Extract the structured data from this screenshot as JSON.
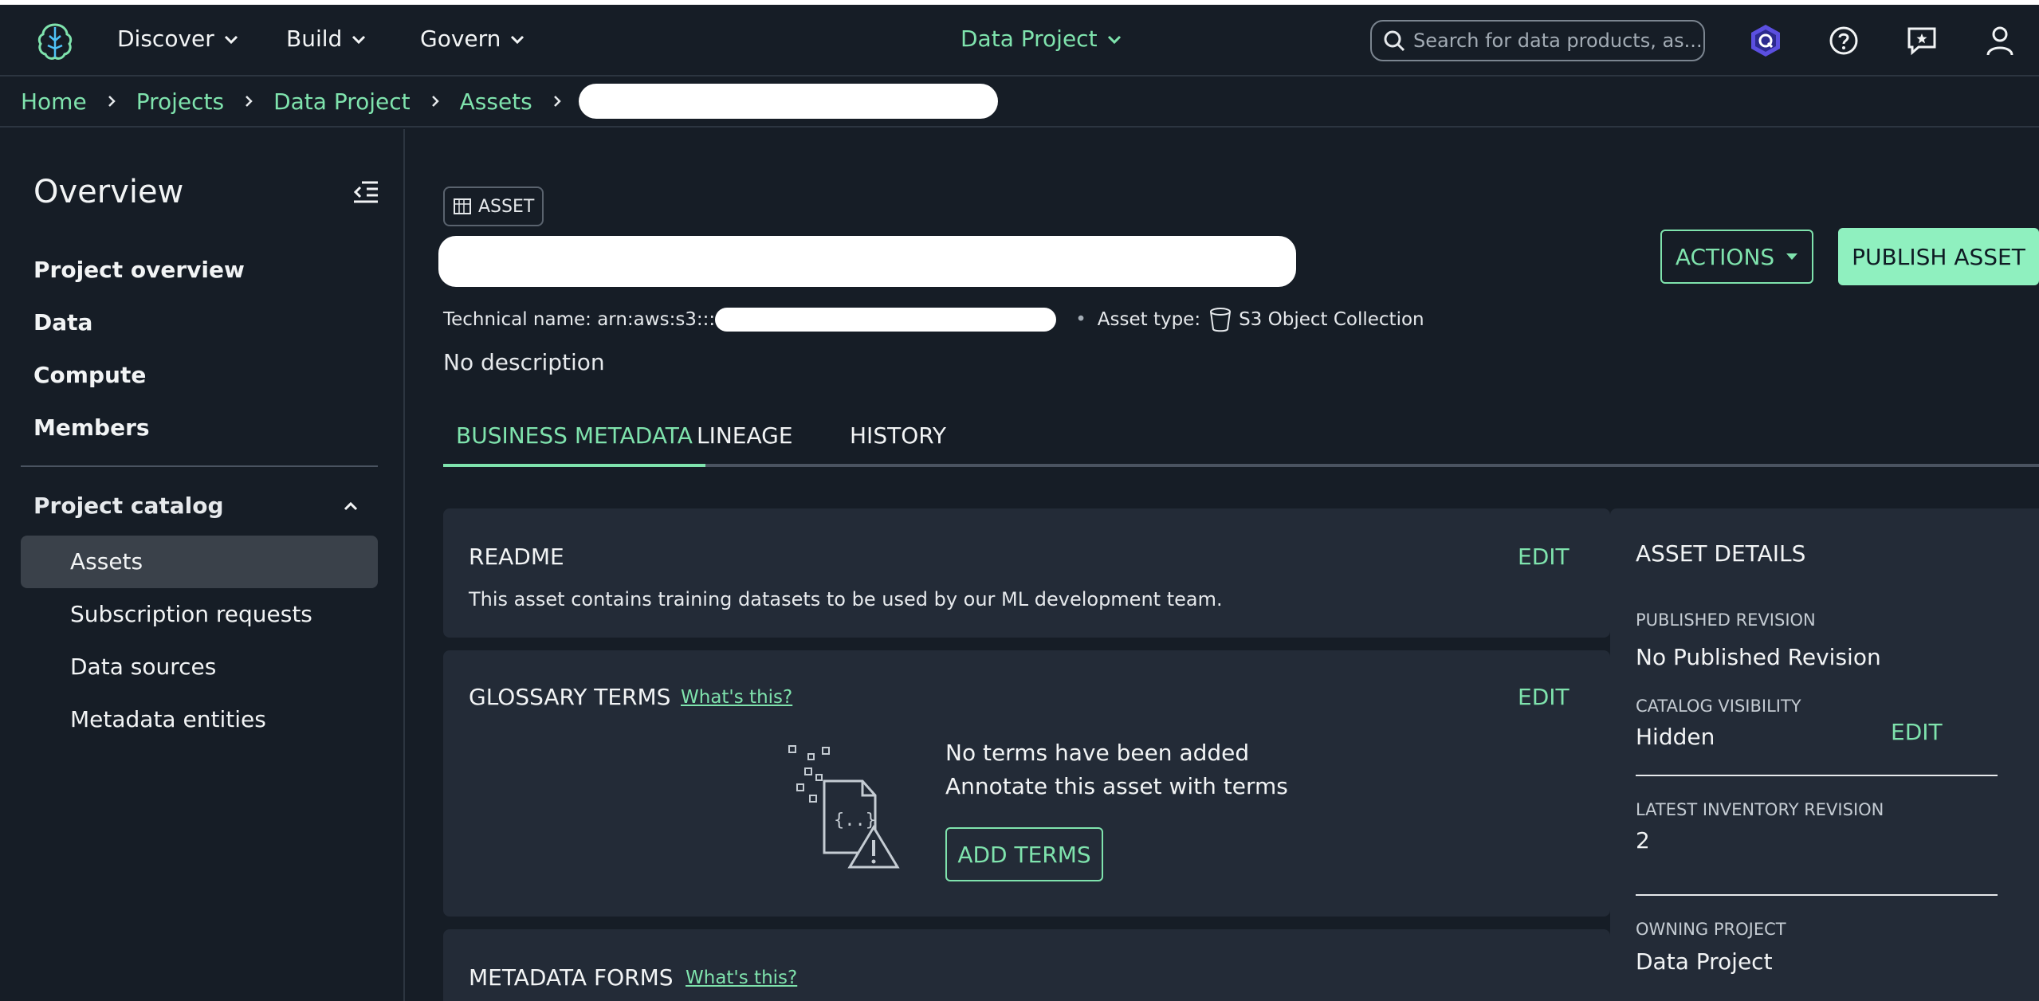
{
  "header": {
    "nav": [
      {
        "label": "Discover"
      },
      {
        "label": "Build"
      },
      {
        "label": "Govern"
      }
    ],
    "project_switcher": "Data Project",
    "search": {
      "placeholder": "Search for data products, as...",
      "value": ""
    },
    "icons": [
      "amazon-q-icon",
      "help-icon",
      "feedback-icon",
      "user-icon"
    ]
  },
  "breadcrumb": {
    "items": [
      "Home",
      "Projects",
      "Data Project",
      "Assets"
    ]
  },
  "sidebar": {
    "title": "Overview",
    "links": [
      "Project overview",
      "Data",
      "Compute",
      "Members"
    ],
    "catalog": {
      "label": "Project catalog",
      "items": [
        "Assets",
        "Subscription requests",
        "Data sources",
        "Metadata entities"
      ],
      "selected": "Assets"
    }
  },
  "asset": {
    "type_chip": "ASSET",
    "technical_name_label": "Technical name: arn:aws:s3:::",
    "asset_type_label": "Asset type:",
    "asset_type_value": "S3 Object Collection",
    "description": "No description",
    "actions_label": "ACTIONS",
    "publish_label": "PUBLISH ASSET"
  },
  "tabs": [
    "BUSINESS METADATA",
    "LINEAGE",
    "HISTORY"
  ],
  "active_tab": "BUSINESS METADATA",
  "readme": {
    "title": "README",
    "edit": "EDIT",
    "text": "This asset contains training datasets to be used by our ML development team."
  },
  "glossary": {
    "title": "GLOSSARY TERMS",
    "whats_this": "What's this?",
    "edit": "EDIT",
    "empty_title": "No terms have been added",
    "empty_sub": "Annotate this asset with terms",
    "add_button": "ADD TERMS"
  },
  "metadata_forms": {
    "title": "METADATA FORMS",
    "whats_this": "What's this?"
  },
  "details": {
    "title": "ASSET DETAILS",
    "published_revision_label": "PUBLISHED REVISION",
    "published_revision_value": "No Published Revision",
    "catalog_visibility_label": "CATALOG VISIBILITY",
    "catalog_visibility_value": "Hidden",
    "catalog_visibility_edit": "EDIT",
    "latest_inventory_label": "LATEST INVENTORY REVISION",
    "latest_inventory_value": "2",
    "owning_project_label": "OWNING PROJECT",
    "owning_project_value": "Data Project"
  },
  "colors": {
    "accent": "#7fe3ad",
    "background": "#161d26",
    "panel": "#232b37",
    "primary_button": "#8ff0bf"
  }
}
